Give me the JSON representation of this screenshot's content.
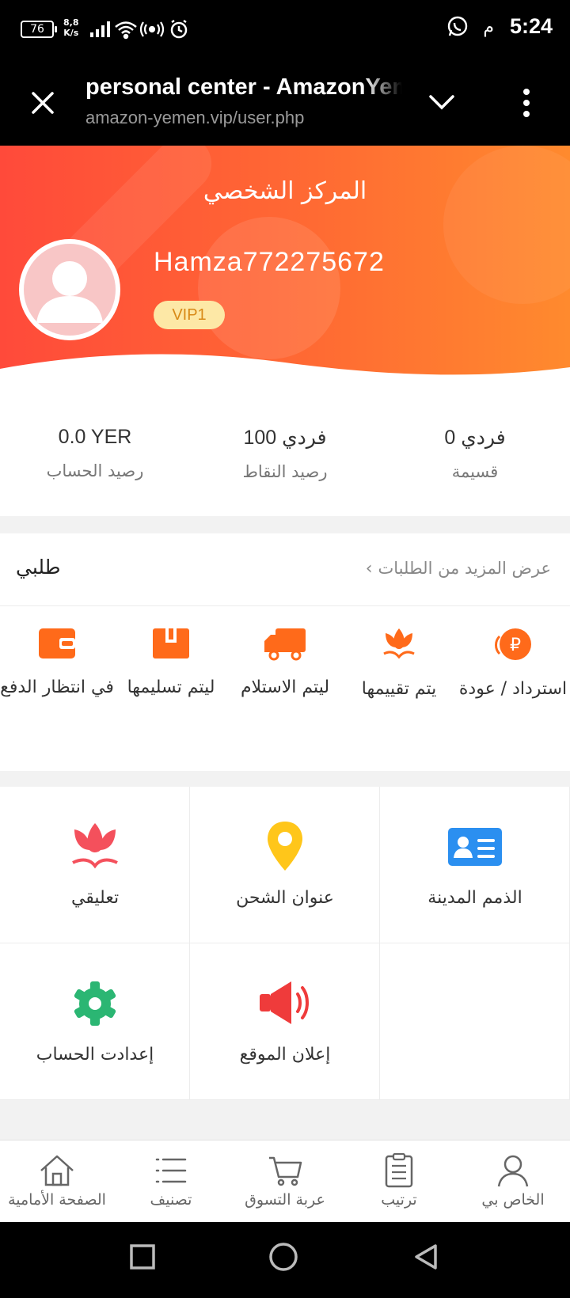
{
  "status_bar": {
    "battery": "76",
    "net_speed_value": "8,8",
    "net_speed_unit": "K/s",
    "ampm": "م",
    "time": "5:24"
  },
  "browser": {
    "title": "personal center - AmazonYemen",
    "url": "amazon-yemen.vip/user.php"
  },
  "header": {
    "page_title": "المركز الشخصي",
    "username": "Hamza772275672",
    "vip_badge": "VIP1"
  },
  "stats": [
    {
      "value": "0.0 YER",
      "label": "رصيد الحساب"
    },
    {
      "value": "فردي 100",
      "label": "رصيد النقاط"
    },
    {
      "value": "فردي 0",
      "label": "قسيمة"
    }
  ],
  "orders": {
    "title": "طلبي",
    "more": "عرض المزيد من الطلبات",
    "items": [
      {
        "label": "في انتظار الدفع",
        "icon": "wallet-icon"
      },
      {
        "label": "ليتم تسليمها",
        "icon": "box-icon"
      },
      {
        "label": "ليتم الاستلام",
        "icon": "truck-icon"
      },
      {
        "label": "يتم تقييمها",
        "icon": "flower-icon"
      },
      {
        "label": "استرداد / عودة",
        "icon": "refund-icon"
      }
    ]
  },
  "grid": [
    {
      "label": "تعليقي",
      "icon": "flower-icon",
      "color": "#f4505c"
    },
    {
      "label": "عنوان الشحن",
      "icon": "location-pin-icon",
      "color": "#ffc61a"
    },
    {
      "label": "الذمم المدينة",
      "icon": "id-card-icon",
      "color": "#2b8ff0"
    },
    {
      "label": "إعدادت الحساب",
      "icon": "gear-icon",
      "color": "#2bb673"
    },
    {
      "label": "إعلان الموقع",
      "icon": "megaphone-icon",
      "color": "#ef3b3b"
    }
  ],
  "bottom_nav": [
    {
      "label": "الصفحة الأمامية",
      "icon": "home-icon"
    },
    {
      "label": "تصنيف",
      "icon": "list-icon"
    },
    {
      "label": "عربة التسوق",
      "icon": "cart-icon"
    },
    {
      "label": "ترتيب",
      "icon": "clipboard-icon"
    },
    {
      "label": "الخاص بي",
      "icon": "user-icon"
    }
  ],
  "colors": {
    "accent": "#ff5a2e",
    "order_icon": "#ff6a1a"
  }
}
